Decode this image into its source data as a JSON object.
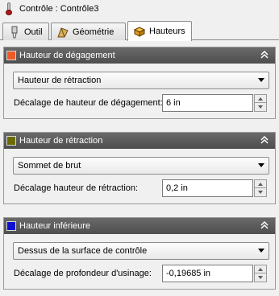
{
  "window": {
    "title": "Contrôle : Contrôle3",
    "icon": "thermometer-icon"
  },
  "tabs": [
    {
      "label": "Outil",
      "icon": "tool-icon",
      "active": false
    },
    {
      "label": "Géométrie",
      "icon": "geometry-icon",
      "active": false
    },
    {
      "label": "Hauteurs",
      "icon": "heights-icon",
      "active": true
    }
  ],
  "panels": [
    {
      "title": "Hauteur de dégagement",
      "color": "#f05a28",
      "dropdown_value": "Hauteur de rétraction",
      "field_label": "Décalage de hauteur de dégagement:",
      "field_value": "6 in"
    },
    {
      "title": "Hauteur de rétraction",
      "color": "#6b6b00",
      "dropdown_value": "Sommet de brut",
      "field_label": "Décalage hauteur de rétraction:",
      "field_value": "0,2 in"
    },
    {
      "title": "Hauteur inférieure",
      "color": "#1010d0",
      "dropdown_value": "Dessus de la surface de contrôle",
      "field_label": "Décalage de profondeur d'usinage:",
      "field_value": "-0,19685 in"
    }
  ]
}
